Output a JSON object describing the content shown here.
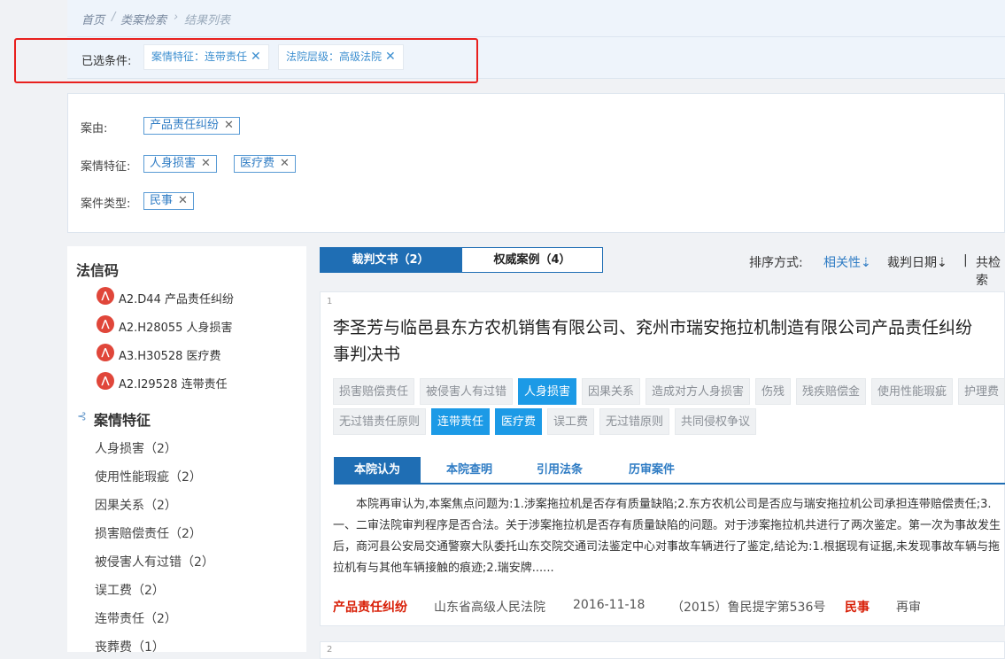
{
  "breadcrumb": [
    "首页",
    "类案检索",
    "结果列表"
  ],
  "selected": {
    "label": "已选条件:",
    "tags": [
      "案情特征：连带责任",
      "法院层级：高级法院"
    ]
  },
  "filters": {
    "case_cause_label": "案由:",
    "case_cause_tags": [
      "产品责任纠纷"
    ],
    "feature_label": "案情特征:",
    "feature_tags": [
      "人身损害",
      "医疗费"
    ],
    "type_label": "案件类型:",
    "type_tags": [
      "民事"
    ]
  },
  "sidebar": {
    "code_title": "法信码",
    "codes": [
      "A2.D44 产品责任纠纷",
      "A2.H28055 人身损害",
      "A3.H30528 医疗费",
      "A2.I29528 连带责任"
    ],
    "feature_title": "案情特征",
    "features": [
      "人身损害（2）",
      "使用性能瑕疵（2）",
      "因果关系（2）",
      "损害赔偿责任（2）",
      "被侵害人有过错（2）",
      "误工费（2）",
      "连带责任（2）",
      "丧葬费（1）"
    ]
  },
  "tabs": {
    "judgments": "裁判文书（2）",
    "authority": "权威案例（4）"
  },
  "sort": {
    "label": "排序方式:",
    "relevance": "相关性⇣",
    "date": "裁判日期⇣",
    "sep": "|",
    "total": "共检索"
  },
  "result": {
    "index": "1",
    "title": "李圣芳与临邑县东方农机销售有限公司、兖州市瑞安拖拉机制造有限公司产品责任纠纷\n事判决书",
    "keywords_row1": [
      {
        "text": "损害赔偿责任",
        "on": false
      },
      {
        "text": "被侵害人有过错",
        "on": false
      },
      {
        "text": "人身损害",
        "on": true
      },
      {
        "text": "因果关系",
        "on": false
      },
      {
        "text": "造成对方人身损害",
        "on": false
      },
      {
        "text": "伤残",
        "on": false
      },
      {
        "text": "残疾赔偿金",
        "on": false
      },
      {
        "text": "使用性能瑕疵",
        "on": false
      },
      {
        "text": "护理费",
        "on": false
      }
    ],
    "keywords_row2": [
      {
        "text": "无过错责任原则",
        "on": false
      },
      {
        "text": "连带责任",
        "on": true
      },
      {
        "text": "医疗费",
        "on": true
      },
      {
        "text": "误工费",
        "on": false
      },
      {
        "text": "无过错原则",
        "on": false
      },
      {
        "text": "共同侵权争议",
        "on": false
      }
    ],
    "subtabs": [
      "本院认为",
      "本院查明",
      "引用法条",
      "历审案件"
    ],
    "summary": "本院再审认为,本案焦点问题为:1.涉案拖拉机是否存有质量缺陷;2.东方农机公司是否应与瑞安拖拉机公司承担连带赔偿责任;3.一、二审法院审判程序是否合法。关于涉案拖拉机是否存有质量缺陷的问题。对于涉案拖拉机共进行了两次鉴定。第一次为事故发生后，商河县公安局交通警察大队委托山东交院交通司法鉴定中心对事故车辆进行了鉴定,结论为:1.根据现有证据,未发现事故车辆与拖拉机有与其他车辆接触的痕迹;2.瑞安牌......",
    "meta": {
      "cause": "产品责任纠纷",
      "court": "山东省高级人民法院",
      "date": "2016-11-18",
      "case_no": "（2015）鲁民提字第536号",
      "type": "民事",
      "procedure": "再审"
    }
  },
  "result2": {
    "index": "2"
  }
}
